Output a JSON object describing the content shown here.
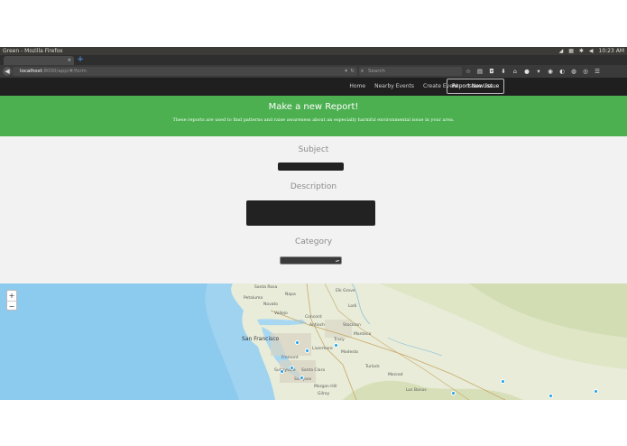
{
  "window": {
    "title": "Green - Mozilla Firefox",
    "clock": "10:23 AM"
  },
  "browser": {
    "tab_close": "×",
    "new_tab": "+",
    "url_host": "localhost",
    "url_path": ":8000/app/#/form",
    "search_placeholder": "Search",
    "icons": [
      "bookmark-star-icon",
      "reading-list-icon",
      "pocket-icon",
      "download-icon",
      "home-icon",
      "chat-icon",
      "sync-icon",
      "menu-icon"
    ]
  },
  "site_nav": {
    "links": [
      "Home",
      "Nearby Events",
      "Create Event",
      "Issue List"
    ],
    "active": "Report New Issue"
  },
  "hero": {
    "title": "Make a new Report!",
    "subtitle": "These reports are used to find patterns and raise awareness about an especially harmful environmental issue in your area."
  },
  "form": {
    "subject_label": "Subject",
    "subject_value": "",
    "description_label": "Description",
    "description_value": "",
    "category_label": "Category",
    "category_value": ""
  },
  "map": {
    "zoom_in": "+",
    "zoom_out": "−",
    "labels": [
      "Santa Rosa",
      "Napa",
      "Vallejo",
      "Concord",
      "Antioch",
      "Stockton",
      "San Francisco",
      "Livermore",
      "Modesto",
      "Fremont",
      "San Jose",
      "Santa Clara",
      "Sunnyvale",
      "Turlock",
      "Merced",
      "Lodi",
      "Elk Grove",
      "Petaluma",
      "Novato",
      "Tracy",
      "Gilroy",
      "Los Banos",
      "Morgan Hill",
      "Manteca"
    ]
  }
}
